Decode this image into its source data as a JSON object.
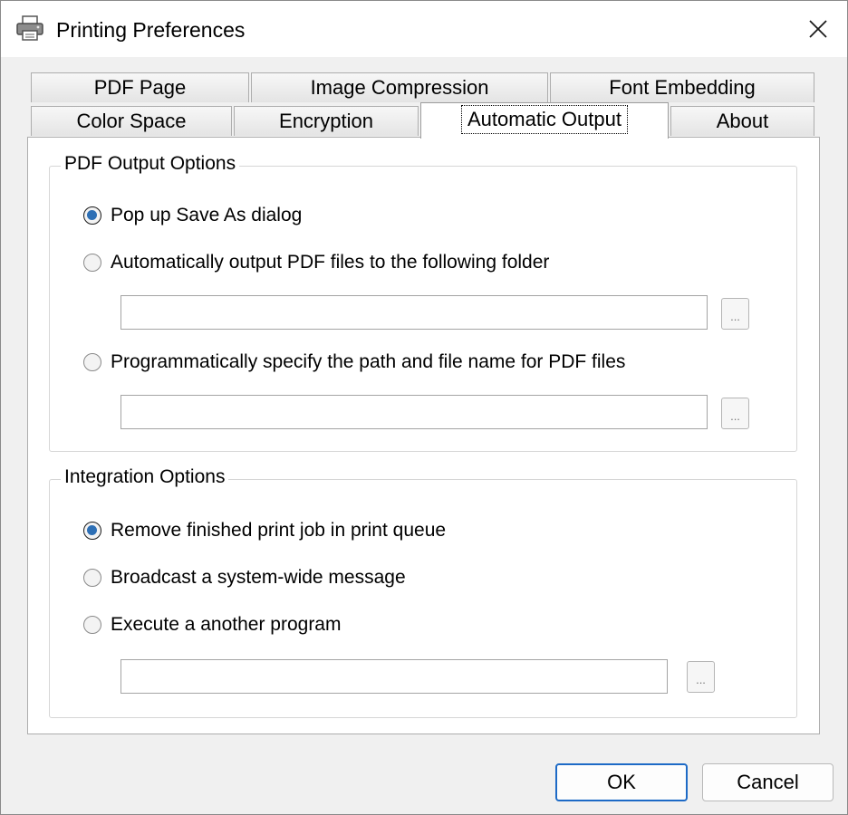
{
  "window": {
    "title": "Printing Preferences",
    "title_icon": "printer-icon",
    "close_icon": "close-icon"
  },
  "tabs": {
    "row1": [
      {
        "label": "PDF Page"
      },
      {
        "label": "Image Compression"
      },
      {
        "label": "Font Embedding"
      }
    ],
    "row2": [
      {
        "label": "Color Space"
      },
      {
        "label": "Encryption"
      },
      {
        "label": "Automatic Output",
        "active": true
      },
      {
        "label": "About"
      }
    ]
  },
  "pdf_output": {
    "legend": "PDF Output Options",
    "options": [
      {
        "label": "Pop up Save As dialog",
        "checked": true
      },
      {
        "label": "Automatically output PDF files to the following folder",
        "checked": false
      },
      {
        "label": "Programmatically specify the path and file name for PDF files",
        "checked": false
      }
    ],
    "folder_value": "",
    "path_value": "",
    "browse_label": "..."
  },
  "integration": {
    "legend": "Integration Options",
    "options": [
      {
        "label": "Remove finished print job in print queue",
        "checked": true
      },
      {
        "label": "Broadcast a system-wide message",
        "checked": false
      },
      {
        "label": "Execute a another program",
        "checked": false
      }
    ],
    "program_value": "",
    "browse_label": "..."
  },
  "buttons": {
    "ok": "OK",
    "cancel": "Cancel"
  },
  "colors": {
    "accent": "#1d6ac6",
    "radio_dot": "#2d6fb5",
    "background": "#f0f0f0"
  }
}
